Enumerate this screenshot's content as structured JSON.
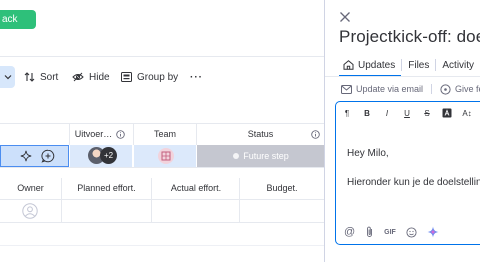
{
  "feedback": {
    "label": "ack"
  },
  "toolbar": {
    "sort_label": "Sort",
    "hide_label": "Hide",
    "group_by_label": "Group by",
    "more_label": "···"
  },
  "columns": {
    "owner_label": "Uitvoer…",
    "team_label": "Team",
    "status_label": "Status"
  },
  "item": {
    "extra_people": "+2",
    "status": "Future step"
  },
  "subitem_columns": [
    "Owner",
    "Planned effort.",
    "Actual effort.",
    "Budget."
  ],
  "panel": {
    "title": "Projectkick-off: doe",
    "tabs": [
      "Updates",
      "Files",
      "Activity"
    ],
    "subtabs": [
      "Update via email",
      "Give fee"
    ],
    "editor": {
      "line1": "Hey Milo,",
      "line2": "Hieronder kun je de doelstellin",
      "bottom": [
        "@",
        "GIF"
      ]
    }
  },
  "colors": {
    "accent": "#0073ea",
    "feedback_green": "#2ec07a",
    "status_grey": "#c5c7d0",
    "selected_row": "#cce0fb"
  }
}
